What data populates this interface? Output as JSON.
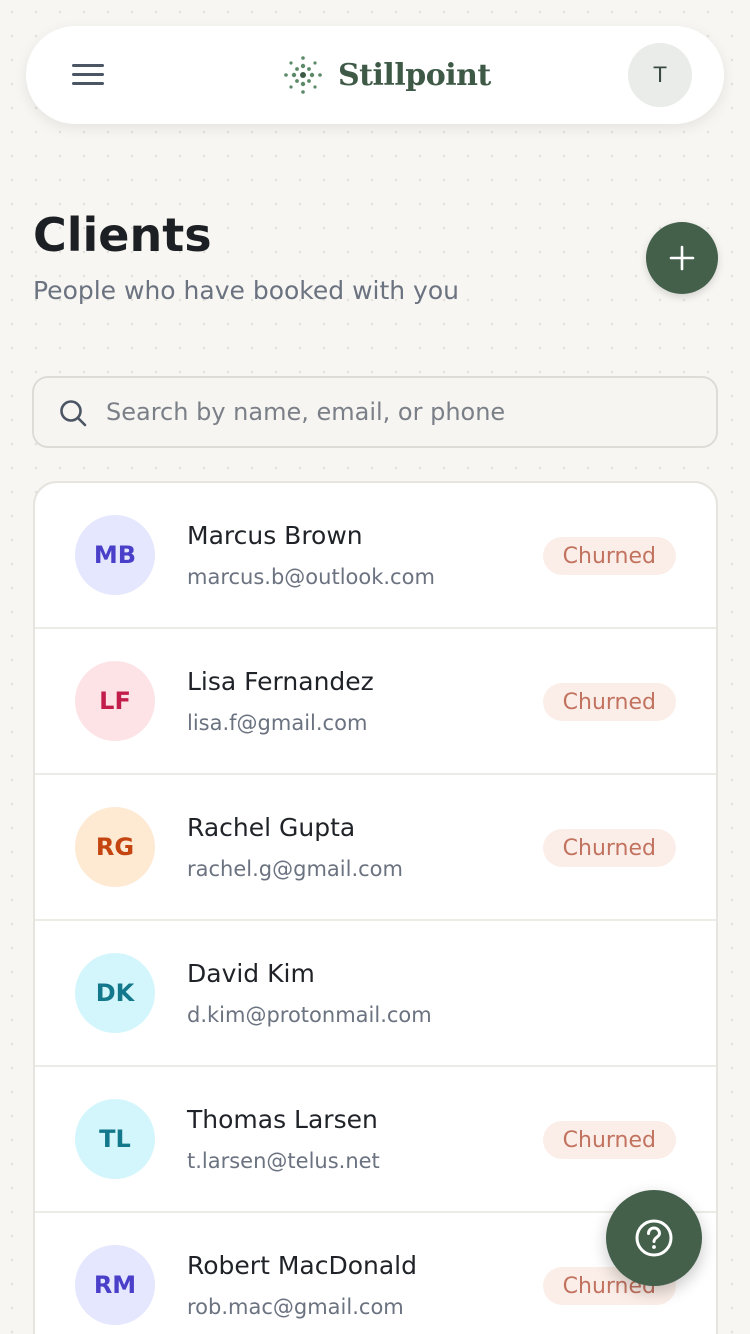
{
  "header": {
    "brand_name": "Stillpoint",
    "user_initial": "T",
    "icons": {
      "menu": "hamburger-menu-icon",
      "logo": "dotted-burst-logo-icon"
    }
  },
  "page": {
    "title": "Clients",
    "subtitle": "People who have booked with you",
    "add_icon": "plus-icon"
  },
  "search": {
    "placeholder": "Search by name, email, or phone",
    "value": "",
    "icon": "search-icon"
  },
  "clients": [
    {
      "initials": "MB",
      "name": "Marcus Brown",
      "email": "marcus.b@outlook.com",
      "status": "Churned",
      "avatar_bg": "#e4e7fd",
      "avatar_fg": "#4a3fc9"
    },
    {
      "initials": "LF",
      "name": "Lisa Fernandez",
      "email": "lisa.f@gmail.com",
      "status": "Churned",
      "avatar_bg": "#fde3e6",
      "avatar_fg": "#c21e4c"
    },
    {
      "initials": "RG",
      "name": "Rachel Gupta",
      "email": "rachel.g@gmail.com",
      "status": "Churned",
      "avatar_bg": "#fee9d3",
      "avatar_fg": "#c4450f"
    },
    {
      "initials": "DK",
      "name": "David Kim",
      "email": "d.kim@protonmail.com",
      "status": "",
      "avatar_bg": "#d3f6fc",
      "avatar_fg": "#13788b"
    },
    {
      "initials": "TL",
      "name": "Thomas Larsen",
      "email": "t.larsen@telus.net",
      "status": "Churned",
      "avatar_bg": "#d3f6fc",
      "avatar_fg": "#13788b"
    },
    {
      "initials": "RM",
      "name": "Robert MacDonald",
      "email": "rob.mac@gmail.com",
      "status": "Churned",
      "avatar_bg": "#e4e7fd",
      "avatar_fg": "#4a3fc9"
    }
  ],
  "help": {
    "icon": "question-circle-icon"
  },
  "colors": {
    "brand": "#3e5a47",
    "accent_button": "#44604b",
    "badge_bg": "#fbeee8",
    "badge_text": "#c27360"
  }
}
